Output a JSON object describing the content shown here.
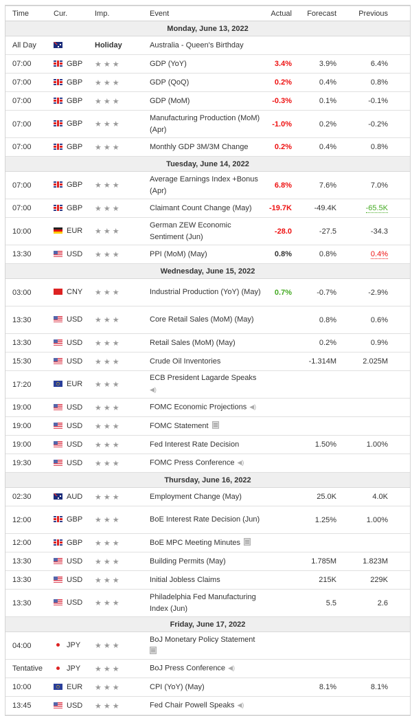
{
  "headers": {
    "time": "Time",
    "currency": "Cur.",
    "importance": "Imp.",
    "event": "Event",
    "actual": "Actual",
    "forecast": "Forecast",
    "previous": "Previous"
  },
  "importance_glyph": "★★★",
  "days": [
    {
      "date": "Monday, June 13, 2022",
      "events": [
        {
          "time": "All Day",
          "flag": "au",
          "currency": "",
          "importance": "Holiday",
          "event": "Australia - Queen's Birthday",
          "actual": "",
          "forecast": "",
          "previous": ""
        },
        {
          "time": "07:00",
          "flag": "gb",
          "currency": "GBP",
          "importance": "3",
          "event": "GDP (YoY)",
          "actual": "3.4%",
          "actual_style": "red",
          "forecast": "3.9%",
          "previous": "6.4%"
        },
        {
          "time": "07:00",
          "flag": "gb",
          "currency": "GBP",
          "importance": "3",
          "event": "GDP (QoQ)",
          "actual": "0.2%",
          "actual_style": "red",
          "forecast": "0.4%",
          "previous": "0.8%"
        },
        {
          "time": "07:00",
          "flag": "gb",
          "currency": "GBP",
          "importance": "3",
          "event": "GDP (MoM)",
          "actual": "-0.3%",
          "actual_style": "red",
          "forecast": "0.1%",
          "previous": "-0.1%"
        },
        {
          "time": "07:00",
          "flag": "gb",
          "currency": "GBP",
          "importance": "3",
          "event": "Manufacturing Production (MoM) (Apr)",
          "actual": "-1.0%",
          "actual_style": "red",
          "forecast": "0.2%",
          "previous": "-0.2%"
        },
        {
          "time": "07:00",
          "flag": "gb",
          "currency": "GBP",
          "importance": "3",
          "event": "Monthly GDP 3M/3M Change",
          "actual": "0.2%",
          "actual_style": "red",
          "forecast": "0.4%",
          "previous": "0.8%"
        }
      ]
    },
    {
      "date": "Tuesday, June 14, 2022",
      "events": [
        {
          "time": "07:00",
          "flag": "gb",
          "currency": "GBP",
          "importance": "3",
          "event": "Average Earnings Index +Bonus (Apr)",
          "actual": "6.8%",
          "actual_style": "red",
          "forecast": "7.6%",
          "previous": "7.0%"
        },
        {
          "time": "07:00",
          "flag": "gb",
          "currency": "GBP",
          "importance": "3",
          "event": "Claimant Count Change (May)",
          "actual": "-19.7K",
          "actual_style": "red",
          "forecast": "-49.4K",
          "previous": "-65.5K",
          "previous_style": "revised-green"
        },
        {
          "time": "10:00",
          "flag": "de",
          "currency": "EUR",
          "importance": "3",
          "event": "German ZEW Economic Sentiment (Jun)",
          "actual": "-28.0",
          "actual_style": "red",
          "forecast": "-27.5",
          "previous": "-34.3"
        },
        {
          "time": "13:30",
          "flag": "us",
          "currency": "USD",
          "importance": "3",
          "event": "PPI (MoM) (May)",
          "actual": "0.8%",
          "actual_style": "neutral",
          "forecast": "0.8%",
          "previous": "0.4%",
          "previous_style": "revised-red"
        }
      ]
    },
    {
      "date": "Wednesday, June 15, 2022",
      "events": [
        {
          "time": "03:00",
          "flag": "cn",
          "currency": "CNY",
          "importance": "3",
          "event": "Industrial Production (YoY) (May)",
          "actual": "0.7%",
          "actual_style": "green",
          "forecast": "-0.7%",
          "previous": "-2.9%"
        },
        {
          "time": "13:30",
          "flag": "us",
          "currency": "USD",
          "importance": "3",
          "event": "Core Retail Sales (MoM) (May)",
          "actual": "",
          "forecast": "0.8%",
          "previous": "0.6%"
        },
        {
          "time": "13:30",
          "flag": "us",
          "currency": "USD",
          "importance": "3",
          "event": "Retail Sales (MoM) (May)",
          "actual": "",
          "forecast": "0.2%",
          "previous": "0.9%"
        },
        {
          "time": "15:30",
          "flag": "us",
          "currency": "USD",
          "importance": "3",
          "event": "Crude Oil Inventories",
          "actual": "",
          "forecast": "-1.314M",
          "previous": "2.025M"
        },
        {
          "time": "17:20",
          "flag": "eu",
          "currency": "EUR",
          "importance": "3",
          "event": "ECB President Lagarde Speaks",
          "icon": "speaker-icon",
          "icon_wrap": true,
          "actual": "",
          "forecast": "",
          "previous": ""
        },
        {
          "time": "19:00",
          "flag": "us",
          "currency": "USD",
          "importance": "3",
          "event": "FOMC Economic Projections",
          "icon": "speaker-icon",
          "actual": "",
          "forecast": "",
          "previous": ""
        },
        {
          "time": "19:00",
          "flag": "us",
          "currency": "USD",
          "importance": "3",
          "event": "FOMC Statement",
          "icon": "document-icon",
          "actual": "",
          "forecast": "",
          "previous": ""
        },
        {
          "time": "19:00",
          "flag": "us",
          "currency": "USD",
          "importance": "3",
          "event": "Fed Interest Rate Decision",
          "actual": "",
          "forecast": "1.50%",
          "previous": "1.00%"
        },
        {
          "time": "19:30",
          "flag": "us",
          "currency": "USD",
          "importance": "3",
          "event": "FOMC Press Conference",
          "icon": "speaker-icon",
          "actual": "",
          "forecast": "",
          "previous": ""
        }
      ]
    },
    {
      "date": "Thursday, June 16, 2022",
      "events": [
        {
          "time": "02:30",
          "flag": "au",
          "currency": "AUD",
          "importance": "3",
          "event": "Employment Change (May)",
          "actual": "",
          "forecast": "25.0K",
          "previous": "4.0K"
        },
        {
          "time": "12:00",
          "flag": "gb",
          "currency": "GBP",
          "importance": "3",
          "event": "BoE Interest Rate Decision (Jun)",
          "actual": "",
          "forecast": "1.25%",
          "previous": "1.00%"
        },
        {
          "time": "12:00",
          "flag": "gb",
          "currency": "GBP",
          "importance": "3",
          "event": "BoE MPC Meeting Minutes",
          "icon": "document-icon",
          "actual": "",
          "forecast": "",
          "previous": ""
        },
        {
          "time": "13:30",
          "flag": "us",
          "currency": "USD",
          "importance": "3",
          "event": "Building Permits (May)",
          "actual": "",
          "forecast": "1.785M",
          "previous": "1.823M"
        },
        {
          "time": "13:30",
          "flag": "us",
          "currency": "USD",
          "importance": "3",
          "event": "Initial Jobless Claims",
          "actual": "",
          "forecast": "215K",
          "previous": "229K"
        },
        {
          "time": "13:30",
          "flag": "us",
          "currency": "USD",
          "importance": "3",
          "event": "Philadelphia Fed Manufacturing Index (Jun)",
          "actual": "",
          "forecast": "5.5",
          "previous": "2.6"
        }
      ]
    },
    {
      "date": "Friday, June 17, 2022",
      "events": [
        {
          "time": "04:00",
          "flag": "jp",
          "currency": "JPY",
          "importance": "3",
          "event": "BoJ Monetary Policy Statement",
          "icon": "document-icon",
          "icon_wrap": true,
          "actual": "",
          "forecast": "",
          "previous": ""
        },
        {
          "time": "Tentative",
          "flag": "jp",
          "currency": "JPY",
          "importance": "3",
          "event": "BoJ Press Conference",
          "icon": "speaker-icon",
          "actual": "",
          "forecast": "",
          "previous": ""
        },
        {
          "time": "10:00",
          "flag": "eu",
          "currency": "EUR",
          "importance": "3",
          "event": "CPI (YoY) (May)",
          "actual": "",
          "forecast": "8.1%",
          "previous": "8.1%"
        },
        {
          "time": "13:45",
          "flag": "us",
          "currency": "USD",
          "importance": "3",
          "event": "Fed Chair Powell Speaks",
          "icon": "speaker-icon",
          "actual": "",
          "forecast": "",
          "previous": ""
        }
      ]
    }
  ],
  "colors": {
    "worse": "#ee1111",
    "better": "#44aa22",
    "day_header_bg": "#efefef",
    "star": "#9a9a9a"
  }
}
